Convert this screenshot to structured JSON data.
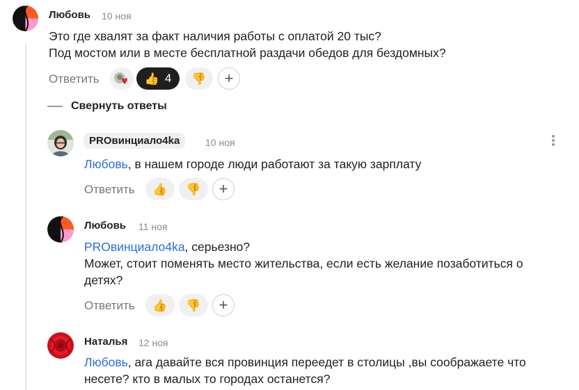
{
  "comments": [
    {
      "author": "Любовь",
      "date": "10 ноя",
      "lines": [
        "Это где хвалят за факт наличия работы с оплатой 20 тыс?",
        "Под мостом или в месте бесплатной раздачи обедов для бездомных?"
      ],
      "reply_label": "Ответить",
      "like_count": "4",
      "avatar_icon": "orange-black-pink-circle-avatar"
    },
    {
      "author": "PROвинциало4ka",
      "date": "10 ноя",
      "mention": "Любовь",
      "text": ", в нашем городе люди работают за такую зарплату",
      "reply_label": "Ответить",
      "avatar_icon": "woman-photo-avatar"
    },
    {
      "author": "Любовь",
      "date": "11 ноя",
      "mention": "PROвинциало4ka",
      "text": ", серьезно?",
      "lines": [
        "Может, стоит поменять место жительства, если есть желание позаботиться о",
        "детях?"
      ],
      "reply_label": "Ответить",
      "avatar_icon": "orange-black-pink-circle-avatar"
    },
    {
      "author": "Наталья",
      "date": "12 ноя",
      "mention": "Любовь",
      "text": ", ага давайте вся провинция переедет в столицы ,вы соображаете что",
      "lines": [
        "несете? кто в малых то городах останется?"
      ],
      "avatar_icon": "red-flower-avatar"
    }
  ],
  "collapse_label": "Свернуть ответы",
  "icons": {
    "like": "thumbs-up-icon",
    "dislike": "thumbs-down-icon",
    "add_reaction": "plus-icon",
    "more": "more-vertical-icon",
    "reactions_group": "emoji-reactions-icon"
  },
  "colors": {
    "mention": "#2a6fdb",
    "active_reaction_bg": "#1f1f1f",
    "reaction_bg": "#f0f0f0"
  },
  "glyphs": {
    "like": "👍",
    "dislike": "👎",
    "plus": "+"
  }
}
